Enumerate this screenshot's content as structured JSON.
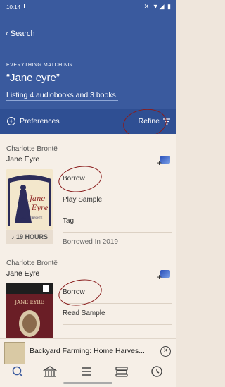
{
  "status": {
    "time": "10:14",
    "icons": "✕ ▼◢ ▮"
  },
  "header": {
    "back_label": "Search",
    "eyebrow": "EVERYTHING MATCHING",
    "query": "“Jane eyre”",
    "listing": "Listing 4 audiobooks and 3 books.",
    "preferences": "Preferences",
    "refine": "Refine"
  },
  "results": [
    {
      "author": "Charlotte Brontë",
      "title": "Jane Eyre",
      "duration": "19 HOURS",
      "actions": [
        "Borrow",
        "Play Sample",
        "Tag",
        "Borrowed In 2019"
      ]
    },
    {
      "author": "Charlotte Brontë",
      "title": "Jane Eyre",
      "actions": [
        "Borrow",
        "Read Sample"
      ]
    }
  ],
  "cover1": {
    "line1": "Jane",
    "line2": "Eyre",
    "author": "CHARLOTTE BRONTË"
  },
  "cover2": {
    "title": "JANE EYRE"
  },
  "mini_player": {
    "title": "Backyard Farming: Home Harves..."
  },
  "tabs": [
    "search",
    "library",
    "menu",
    "shelf",
    "activity"
  ]
}
